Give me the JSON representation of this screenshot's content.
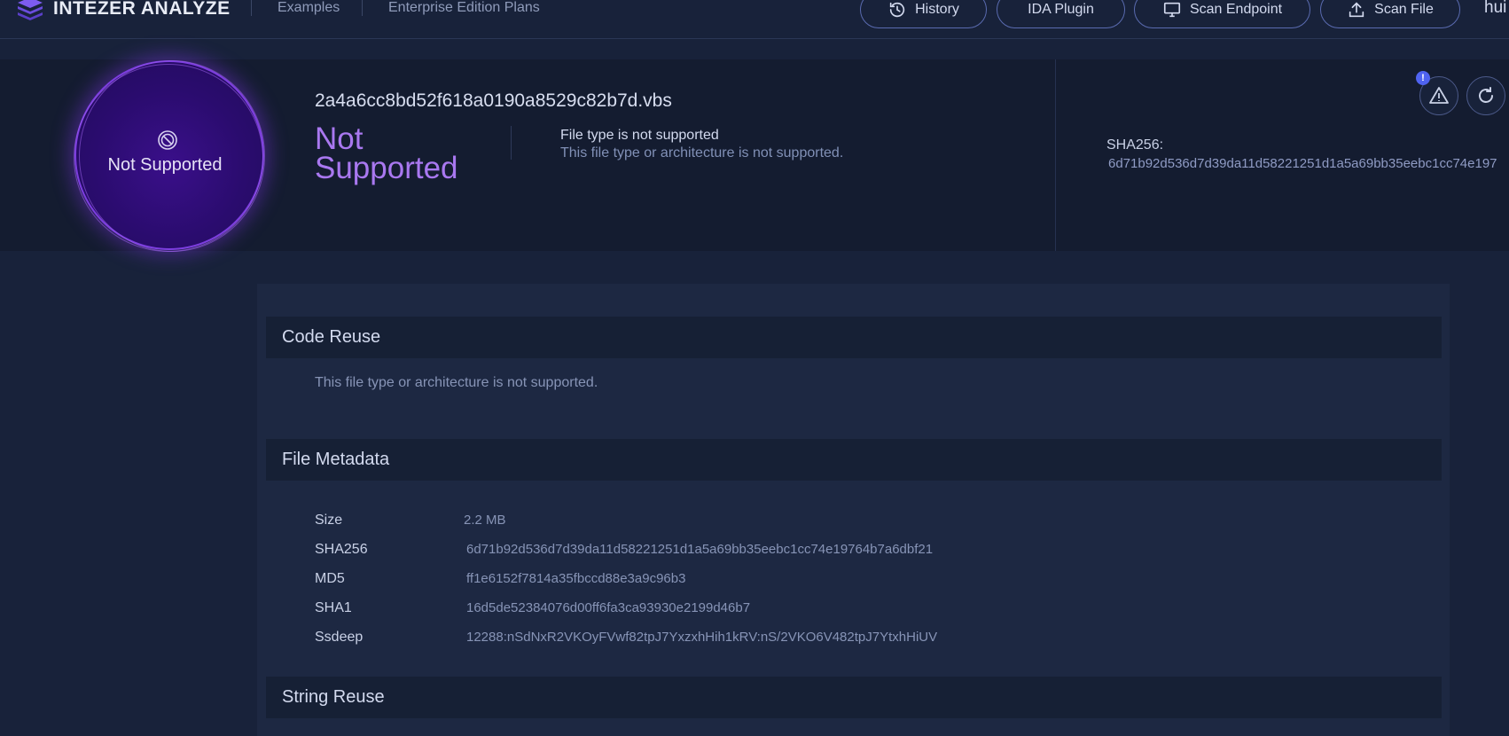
{
  "brand": {
    "name": "INTEZER ANALYZE",
    "color": "#7d5cf0",
    "icon": "intezer-logo-icon"
  },
  "nav": {
    "links": [
      "Examples",
      "Enterprise Edition Plans"
    ],
    "buttons": [
      {
        "label": "History",
        "icon": "history-icon"
      },
      {
        "label": "IDA Plugin",
        "icon": ""
      },
      {
        "label": "Scan Endpoint",
        "icon": "monitor-icon"
      },
      {
        "label": "Scan File",
        "icon": "upload-icon"
      }
    ],
    "user_partial": "hui"
  },
  "header": {
    "verdict_badge_label": "Not Supported",
    "verdict_badge_icon": "block-icon",
    "file_name": "2a4a6cc8bd52f618a0190a8529c82b7d.vbs",
    "verdict_title": "Not Supported",
    "verdict_color": "#a978f0",
    "description_title": "File type is not supported",
    "description_text": "This file type or architecture is not supported.",
    "sha256_label": "SHA256:",
    "sha256_value": "6d71b92d536d7d39da11d58221251d1a5a69bb35eebc1cc74e197",
    "actions": [
      {
        "icon": "warning-icon",
        "notification": "!"
      },
      {
        "icon": "refresh-icon"
      }
    ]
  },
  "sections": {
    "code_reuse": {
      "title": "Code Reuse",
      "note": "This file type or architecture is not supported."
    },
    "file_metadata": {
      "title": "File Metadata",
      "rows": [
        {
          "key": "Size",
          "value": "2.2 MB"
        },
        {
          "key": "SHA256",
          "value": "6d71b92d536d7d39da11d58221251d1a5a69bb35eebc1cc74e19764b7a6dbf21"
        },
        {
          "key": "MD5",
          "value": "ff1e6152f7814a35fbccd88e3a9c96b3"
        },
        {
          "key": "SHA1",
          "value": "16d5de52384076d00ff6fa3ca93930e2199d46b7"
        },
        {
          "key": "Ssdeep",
          "value": "12288:nSdNxR2VKOyFVwf82tpJ7YxzxhHih1kRV:nS/2VKO6V482tpJ7YtxhHiUV"
        }
      ]
    },
    "string_reuse": {
      "title": "String Reuse"
    }
  }
}
